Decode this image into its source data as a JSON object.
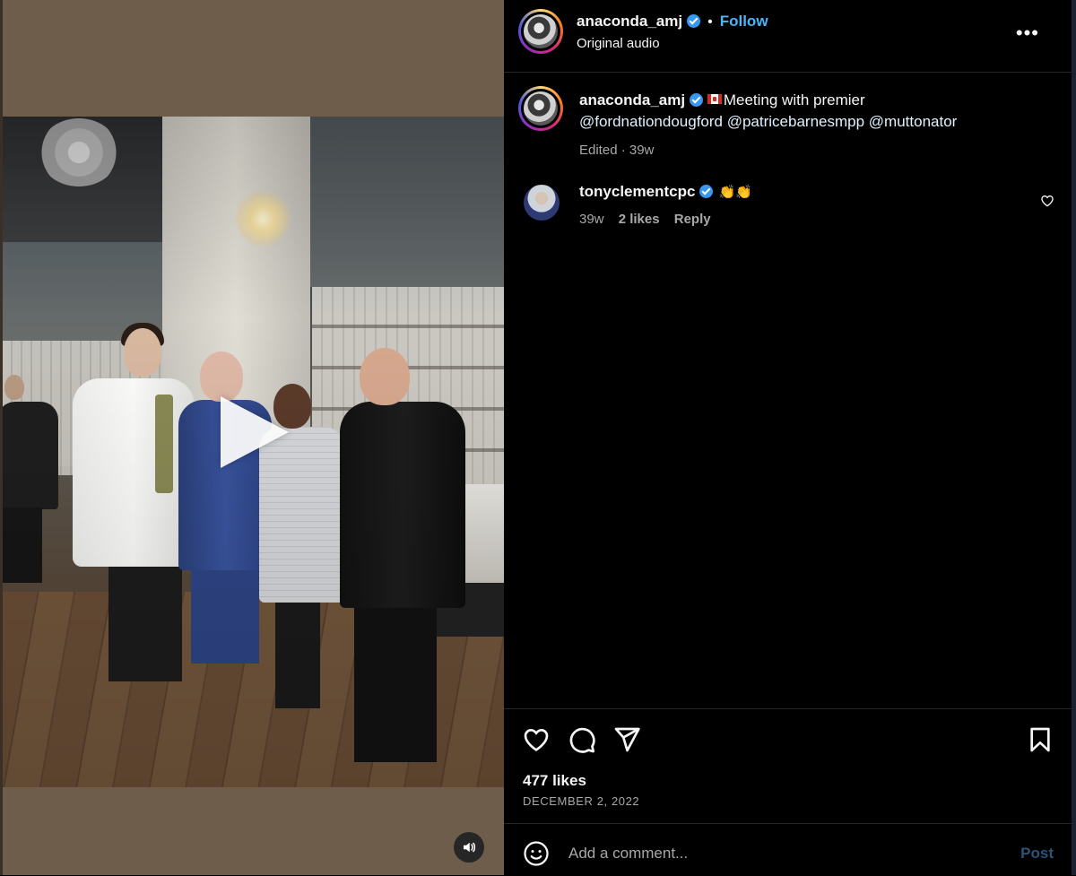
{
  "post": {
    "author": "anaconda_amj",
    "follow_label": "Follow",
    "separator": "•",
    "audio_label": "Original audio",
    "more_label": "•••",
    "caption_text": "Meeting with premier",
    "mentions": [
      "@fordnationdougford",
      "@patricebarnesmpp",
      "@muttonator"
    ],
    "caption_meta": "Edited · 39w",
    "likes": "477 likes",
    "date": "DECEMBER 2, 2022"
  },
  "comment": {
    "author": "tonyclementcpc",
    "text": "👏👏",
    "age": "39w",
    "likes": "2 likes",
    "reply_label": "Reply"
  },
  "composer": {
    "placeholder": "Add a comment...",
    "post_label": "Post"
  },
  "icons": {
    "verified": "verified-badge-icon",
    "flag": "canada-flag-icon",
    "like": "heart-icon",
    "comment": "comment-bubble-icon",
    "share": "paper-plane-icon",
    "save": "bookmark-icon",
    "emoji": "smiley-icon",
    "play": "play-icon",
    "mute": "speaker-icon"
  },
  "colors": {
    "accent": "#4cb5f9",
    "post_disabled": "#2a5478",
    "muted_text": "#a8a8a8"
  }
}
